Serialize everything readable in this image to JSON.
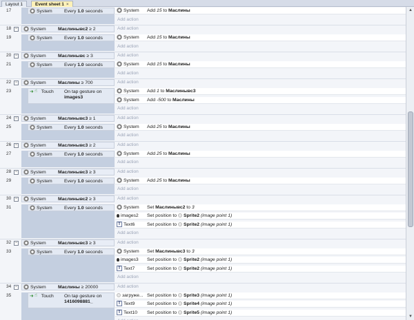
{
  "tabs": [
    {
      "label": "Layout 1",
      "active": false
    },
    {
      "label": "Event sheet 1",
      "active": true,
      "close": "×"
    }
  ],
  "add_action": "Add action",
  "events": [
    {
      "num": "17",
      "kind": "sub",
      "obj": "System",
      "cond": "Every ",
      "bold": "1.0",
      "tail": " seconds",
      "actions": [
        {
          "obj": "System",
          "pre": "Add ",
          "it": "15",
          "mid": " to ",
          "b": "Маслины",
          "post": ""
        }
      ]
    },
    {
      "num": "18",
      "kind": "group",
      "obj": "System",
      "cond": "",
      "bold": "Маслинывс2",
      "tail": " ≥ 2"
    },
    {
      "num": "19",
      "kind": "sub",
      "obj": "System",
      "cond": "Every ",
      "bold": "1.0",
      "tail": " seconds",
      "actions": [
        {
          "obj": "System",
          "pre": "Add ",
          "it": "15",
          "mid": " to ",
          "b": "Маслины",
          "post": ""
        }
      ]
    },
    {
      "num": "20",
      "kind": "group",
      "obj": "System",
      "cond": "",
      "bold": "Маслинывс",
      "tail": " ≥ 3"
    },
    {
      "num": "21",
      "kind": "sub",
      "obj": "System",
      "cond": "Every ",
      "bold": "1.0",
      "tail": " seconds",
      "actions": [
        {
          "obj": "System",
          "pre": "Add ",
          "it": "15",
          "mid": " to ",
          "b": "Маслины",
          "post": ""
        }
      ]
    },
    {
      "num": "22",
      "kind": "group",
      "obj": "System",
      "cond": "",
      "bold": "Маслины",
      "tail": " ≥ 700"
    },
    {
      "num": "23",
      "kind": "touch",
      "obj": "Touch",
      "cond": "On tap gesture on ",
      "bold": "images3",
      "tail": "",
      "actions": [
        {
          "obj": "System",
          "pre": "Add ",
          "it": "1",
          "mid": " to ",
          "b": "Маслинывс3",
          "post": ""
        },
        {
          "obj": "System",
          "pre": "Add ",
          "it": "-500",
          "mid": " to ",
          "b": "Маслины",
          "post": ""
        }
      ]
    },
    {
      "num": "24",
      "kind": "group",
      "obj": "System",
      "cond": "",
      "bold": "Маслинывс3",
      "tail": " ≥ 1"
    },
    {
      "num": "25",
      "kind": "sub",
      "obj": "System",
      "cond": "Every ",
      "bold": "1.0",
      "tail": " seconds",
      "actions": [
        {
          "obj": "System",
          "pre": "Add ",
          "it": "25",
          "mid": " to ",
          "b": "Маслины",
          "post": ""
        }
      ]
    },
    {
      "num": "26",
      "kind": "group",
      "obj": "System",
      "cond": "",
      "bold": "Маслинывс3",
      "tail": " ≥ 2"
    },
    {
      "num": "27",
      "kind": "sub",
      "obj": "System",
      "cond": "Every ",
      "bold": "1.0",
      "tail": " seconds",
      "actions": [
        {
          "obj": "System",
          "pre": "Add ",
          "it": "25",
          "mid": " to ",
          "b": "Маслины",
          "post": ""
        }
      ]
    },
    {
      "num": "28",
      "kind": "group",
      "obj": "System",
      "cond": "",
      "bold": "Маслинывс3",
      "tail": " ≥ 3"
    },
    {
      "num": "29",
      "kind": "sub",
      "obj": "System",
      "cond": "Every ",
      "bold": "1.0",
      "tail": " seconds",
      "actions": [
        {
          "obj": "System",
          "pre": "Add ",
          "it": "25",
          "mid": " to ",
          "b": "Маслины",
          "post": ""
        }
      ]
    },
    {
      "num": "30",
      "kind": "group",
      "obj": "System",
      "cond": "",
      "bold": "Маслинывс2",
      "tail": " ≥ 3"
    },
    {
      "num": "31",
      "kind": "sub",
      "obj": "System",
      "cond": "Every ",
      "bold": "1.0",
      "tail": " seconds",
      "actions": [
        {
          "obj": "System",
          "pre": "Set ",
          "b": "Маслинывс2",
          "mid": " to ",
          "it": "3",
          "post": "",
          "order": "bi"
        },
        {
          "obj": "images2",
          "pre": "Set position to ",
          "b": "Sprite2",
          "it": "(image point 1)",
          "icon": "sprite"
        },
        {
          "obj": "Text6",
          "pre": "Set position to ",
          "b": "Sprite2",
          "it": "(image point 1)",
          "icon": "text"
        }
      ]
    },
    {
      "num": "32",
      "kind": "group",
      "obj": "System",
      "cond": "",
      "bold": "Маслинывс3",
      "tail": " ≥ 3"
    },
    {
      "num": "33",
      "kind": "sub",
      "obj": "System",
      "cond": "Every ",
      "bold": "1.0",
      "tail": " seconds",
      "actions": [
        {
          "obj": "System",
          "pre": "Set ",
          "b": "Маслинывс3",
          "mid": " to ",
          "it": "3",
          "post": "",
          "order": "bi"
        },
        {
          "obj": "images3",
          "pre": "Set position to ",
          "b": "Sprite2",
          "it": "(image point 1)",
          "icon": "sprite"
        },
        {
          "obj": "Text7",
          "pre": "Set position to ",
          "b": "Sprite2",
          "it": "(image point 1)",
          "icon": "text"
        }
      ]
    },
    {
      "num": "34",
      "kind": "group",
      "obj": "System",
      "cond": "",
      "bold": "Маслины",
      "tail": " ≥ 20000"
    },
    {
      "num": "35",
      "kind": "touch",
      "obj": "Touch",
      "cond": "On tap gesture on ",
      "bold": "1416098881_",
      "tail": "",
      "actions": [
        {
          "obj": "загруже...",
          "pre": "Set position to ",
          "b": "Sprite3",
          "it": "(image point 1)",
          "icon": "blank"
        },
        {
          "obj": "Text9",
          "pre": "Set position to ",
          "b": "Sprite4",
          "it": "(image point 1)",
          "icon": "text"
        },
        {
          "obj": "Text10",
          "pre": "Set position to ",
          "b": "Sprite5",
          "it": "(image point 1)",
          "icon": "text"
        }
      ]
    }
  ]
}
